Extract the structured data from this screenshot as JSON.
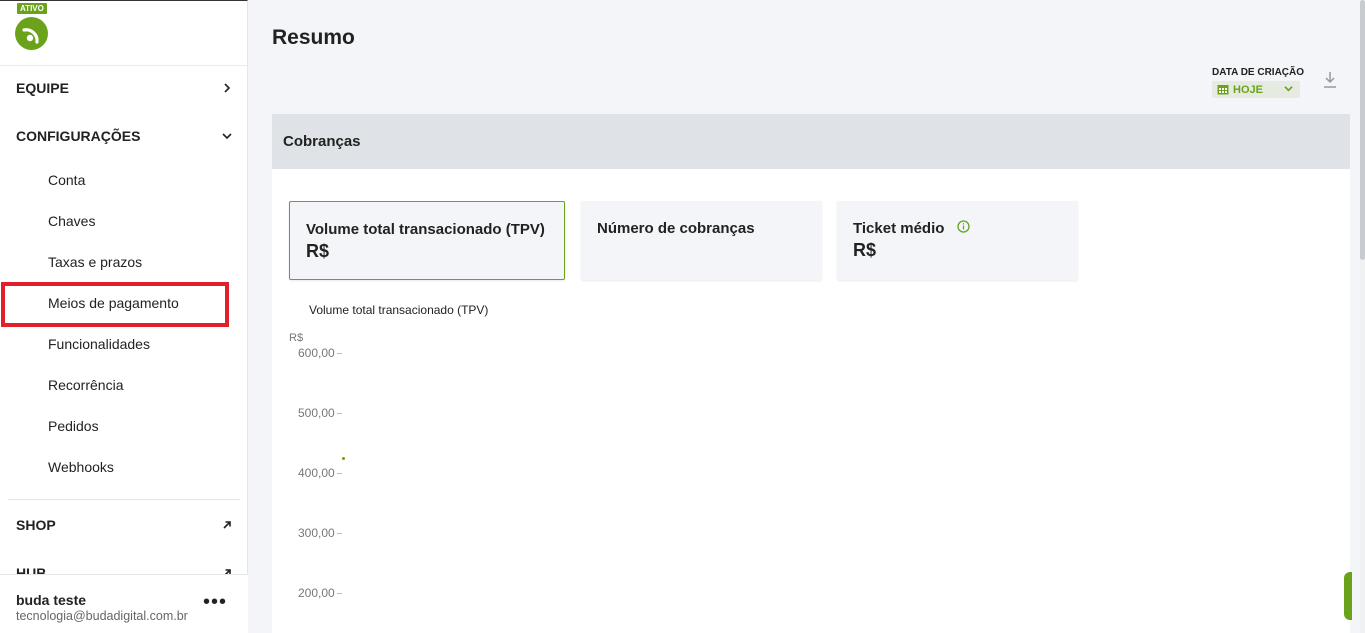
{
  "sidebar": {
    "badge": "ATIVO",
    "brand_color": "#6aa31b",
    "sections": [
      {
        "label": "EQUIPE",
        "icon": "chevron-right-icon"
      },
      {
        "label": "CONFIGURAÇÕES",
        "icon": "chevron-down-icon"
      }
    ],
    "sub_items": [
      "Conta",
      "Chaves",
      "Taxas e prazos",
      "Meios de pagamento",
      "Funcionalidades",
      "Recorrência",
      "Pedidos",
      "Webhooks"
    ],
    "highlighted_item": "Meios de pagamento",
    "highlight_color": "#e0202a",
    "external_links": [
      {
        "label": "SHOP",
        "icon": "external-link-icon"
      },
      {
        "label": "HUB",
        "icon": "external-link-icon"
      }
    ],
    "user": {
      "name": "buda teste",
      "email": "tecnologia@budadigital.com.br",
      "more": "•••"
    }
  },
  "main": {
    "title": "Resumo",
    "filter": {
      "label": "DATA DE CRIAÇÃO",
      "value": "HOJE",
      "icon": "calendar-icon"
    },
    "download_icon": "download-icon",
    "panel_title": "Cobranças",
    "cards": [
      {
        "title": "Volume total transacionado (TPV)",
        "value": "R$",
        "active": true
      },
      {
        "title": "Número de cobranças",
        "value": "",
        "active": false
      },
      {
        "title": "Ticket médio",
        "value": "R$",
        "active": false,
        "icon": "info-icon"
      }
    ],
    "chart": {
      "title": "Volume total transacionado (TPV)",
      "unit": "R$",
      "ticks": [
        "600,00",
        "500,00",
        "400,00",
        "300,00",
        "200,00"
      ]
    }
  }
}
